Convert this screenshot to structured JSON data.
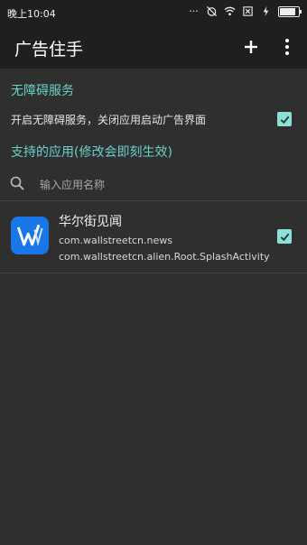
{
  "status_bar": {
    "time": "晚上10:04",
    "icons": [
      "dots-icon",
      "alarm-off-icon",
      "wifi-icon",
      "sim-icon",
      "charging-icon",
      "battery-icon"
    ],
    "battery_level": 0.85
  },
  "app_bar": {
    "title": "广告住手",
    "add_icon": "plus-icon",
    "more_icon": "more-vert-icon"
  },
  "accessibility": {
    "header": "无障碍服务",
    "toggle_label": "开启无障碍服务，关闭应用启动广告界面",
    "enabled": true
  },
  "apps_section": {
    "header": "支持的应用(修改会即刻生效)",
    "search_placeholder": "输入应用名称",
    "items": [
      {
        "name": "华尔街见闻",
        "package": "com.wallstreetcn.news",
        "activity": "com.wallstreetcn.alien.Root.SplashActivity",
        "checked": true
      }
    ]
  },
  "colors": {
    "accent": "#6ad1c8",
    "checkbox": "#8ee0d7",
    "appbar": "#1f1f1f",
    "background": "#2f2f2f",
    "app_icon": "#1976e6"
  }
}
